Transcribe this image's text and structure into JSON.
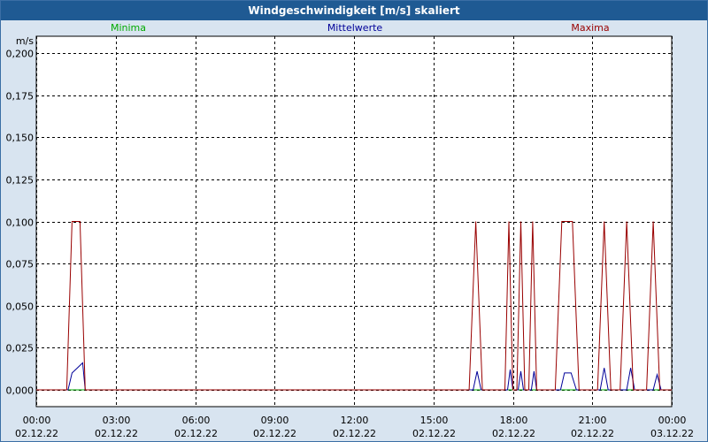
{
  "window": {
    "title": "Windgeschwindigkeit [m/s] skaliert"
  },
  "colors": {
    "min": "#00aa00",
    "mean": "#000099",
    "max": "#990000",
    "titlebar": "#1f5a93",
    "background": "#d8e4f0"
  },
  "chart_data": {
    "type": "line",
    "title": "Windgeschwindigkeit [m/s] skaliert",
    "ylabel": "m/s",
    "xlabel": "",
    "ylim": [
      -0.01,
      0.21
    ],
    "xlim": [
      0,
      24
    ],
    "grid": true,
    "legend": "top",
    "y_ticks": [
      "0,200",
      "0,175",
      "0,150",
      "0,125",
      "0,100",
      "0,075",
      "0,050",
      "0,025",
      "0,000"
    ],
    "x_ticks": [
      {
        "time": "00:00",
        "date": "02.12.22"
      },
      {
        "time": "03:00",
        "date": "02.12.22"
      },
      {
        "time": "06:00",
        "date": "02.12.22"
      },
      {
        "time": "09:00",
        "date": "02.12.22"
      },
      {
        "time": "12:00",
        "date": "02.12.22"
      },
      {
        "time": "15:00",
        "date": "02.12.22"
      },
      {
        "time": "18:00",
        "date": "02.12.22"
      },
      {
        "time": "21:00",
        "date": "02.12.22"
      },
      {
        "time": "00:00",
        "date": "03.12.22"
      }
    ],
    "series": [
      {
        "name": "Minima",
        "color": "#00aa00",
        "points": [
          [
            0,
            0
          ],
          [
            24,
            0
          ]
        ]
      },
      {
        "name": "Mittelwerte",
        "color": "#000099",
        "points": [
          [
            0,
            0
          ],
          [
            1.2,
            0
          ],
          [
            1.35,
            0.01
          ],
          [
            1.55,
            0.013
          ],
          [
            1.75,
            0.016
          ],
          [
            1.85,
            0
          ],
          [
            16.5,
            0
          ],
          [
            16.65,
            0.011
          ],
          [
            16.8,
            0
          ],
          [
            17.8,
            0
          ],
          [
            17.9,
            0.012
          ],
          [
            18.0,
            0
          ],
          [
            18.2,
            0
          ],
          [
            18.3,
            0.011
          ],
          [
            18.4,
            0
          ],
          [
            18.7,
            0
          ],
          [
            18.8,
            0.011
          ],
          [
            18.9,
            0
          ],
          [
            19.8,
            0
          ],
          [
            19.95,
            0.01
          ],
          [
            20.2,
            0.01
          ],
          [
            20.4,
            0
          ],
          [
            21.3,
            0
          ],
          [
            21.45,
            0.013
          ],
          [
            21.6,
            0
          ],
          [
            22.3,
            0
          ],
          [
            22.45,
            0.013
          ],
          [
            22.6,
            0
          ],
          [
            23.3,
            0
          ],
          [
            23.45,
            0.009
          ],
          [
            23.6,
            0
          ],
          [
            24,
            0
          ]
        ]
      },
      {
        "name": "Maxima",
        "color": "#990000",
        "points": [
          [
            0,
            0
          ],
          [
            1.15,
            0
          ],
          [
            1.35,
            0.1
          ],
          [
            1.65,
            0.1
          ],
          [
            1.85,
            0
          ],
          [
            16.35,
            0
          ],
          [
            16.6,
            0.1
          ],
          [
            16.85,
            0
          ],
          [
            17.7,
            0
          ],
          [
            17.85,
            0.1
          ],
          [
            18.0,
            0
          ],
          [
            18.15,
            0
          ],
          [
            18.3,
            0.1
          ],
          [
            18.45,
            0
          ],
          [
            18.6,
            0
          ],
          [
            18.75,
            0.1
          ],
          [
            18.9,
            0
          ],
          [
            19.6,
            0
          ],
          [
            19.85,
            0.1
          ],
          [
            20.25,
            0.1
          ],
          [
            20.5,
            0
          ],
          [
            21.2,
            0
          ],
          [
            21.45,
            0.1
          ],
          [
            21.7,
            0
          ],
          [
            22.05,
            0
          ],
          [
            22.3,
            0.1
          ],
          [
            22.55,
            0
          ],
          [
            23.05,
            0
          ],
          [
            23.3,
            0.1
          ],
          [
            23.55,
            0
          ],
          [
            24,
            0
          ]
        ]
      }
    ]
  }
}
